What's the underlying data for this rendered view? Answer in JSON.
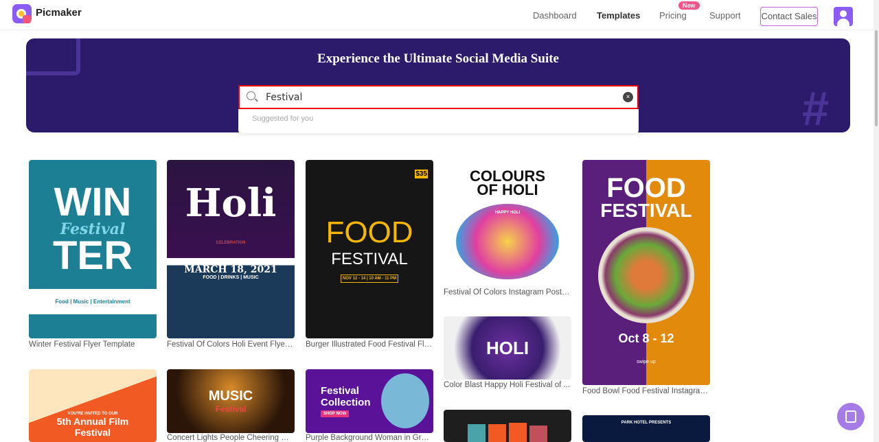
{
  "nav": {
    "brand": "Picmaker",
    "links": [
      "Dashboard",
      "Templates",
      "Pricing",
      "Support"
    ],
    "active": "Templates",
    "new_badge": "New",
    "contact": "Contact Sales"
  },
  "banner": {
    "title": "Experience the Ultimate Social Media Suite",
    "bg": "#2c1a6b"
  },
  "search": {
    "value": "Festival",
    "clear": "×",
    "suggestion_header": "Suggested for you"
  },
  "templates": [
    {
      "caption": "Winter Festival Flyer Template",
      "art": [
        "WIN",
        "Festival",
        "TER",
        "Food | Music | Entertainment"
      ]
    },
    {
      "caption": "Festival Of Colors Holi Event Flyer ...",
      "art": [
        "Holi",
        "CELEBRATION",
        "MARCH 18, 2021",
        "FOOD | DRINKS | MUSIC"
      ]
    },
    {
      "caption": "Burger Illustrated Food Festival Fly...",
      "art": [
        "FOOD",
        "FESTIVAL",
        "NOV 12 - 14 | 10 AM - 11 PM",
        "$35"
      ]
    },
    {
      "caption": "Festival Of Colors Instagram Post T...",
      "art": [
        "COLOURS",
        "OF HOLI",
        "HAPPY HOLI"
      ]
    },
    {
      "caption": "Food Bowl Food Festival Instagram...",
      "art": [
        "FOOD",
        "FESTIVAL",
        "Oct 8 - 12",
        "swipe up"
      ]
    },
    {
      "caption": "Color Blast Happy Holi Festival of ...",
      "art": [
        "HOLI"
      ]
    },
    {
      "caption": "",
      "art": [
        "YOU'RE INVITED TO OUR",
        "5th Annual Film",
        "Festival"
      ]
    },
    {
      "caption": "Concert Lights People Cheering Mu...",
      "art": [
        "MUSIC",
        "Festival"
      ]
    },
    {
      "caption": "Purple Background Woman in Gree...",
      "art": [
        "Festival",
        "Collection",
        "SHOP NOW"
      ]
    },
    {
      "caption": "",
      "art": []
    },
    {
      "caption": "",
      "art": [
        "PARK HOTEL PRESENTS"
      ]
    }
  ]
}
